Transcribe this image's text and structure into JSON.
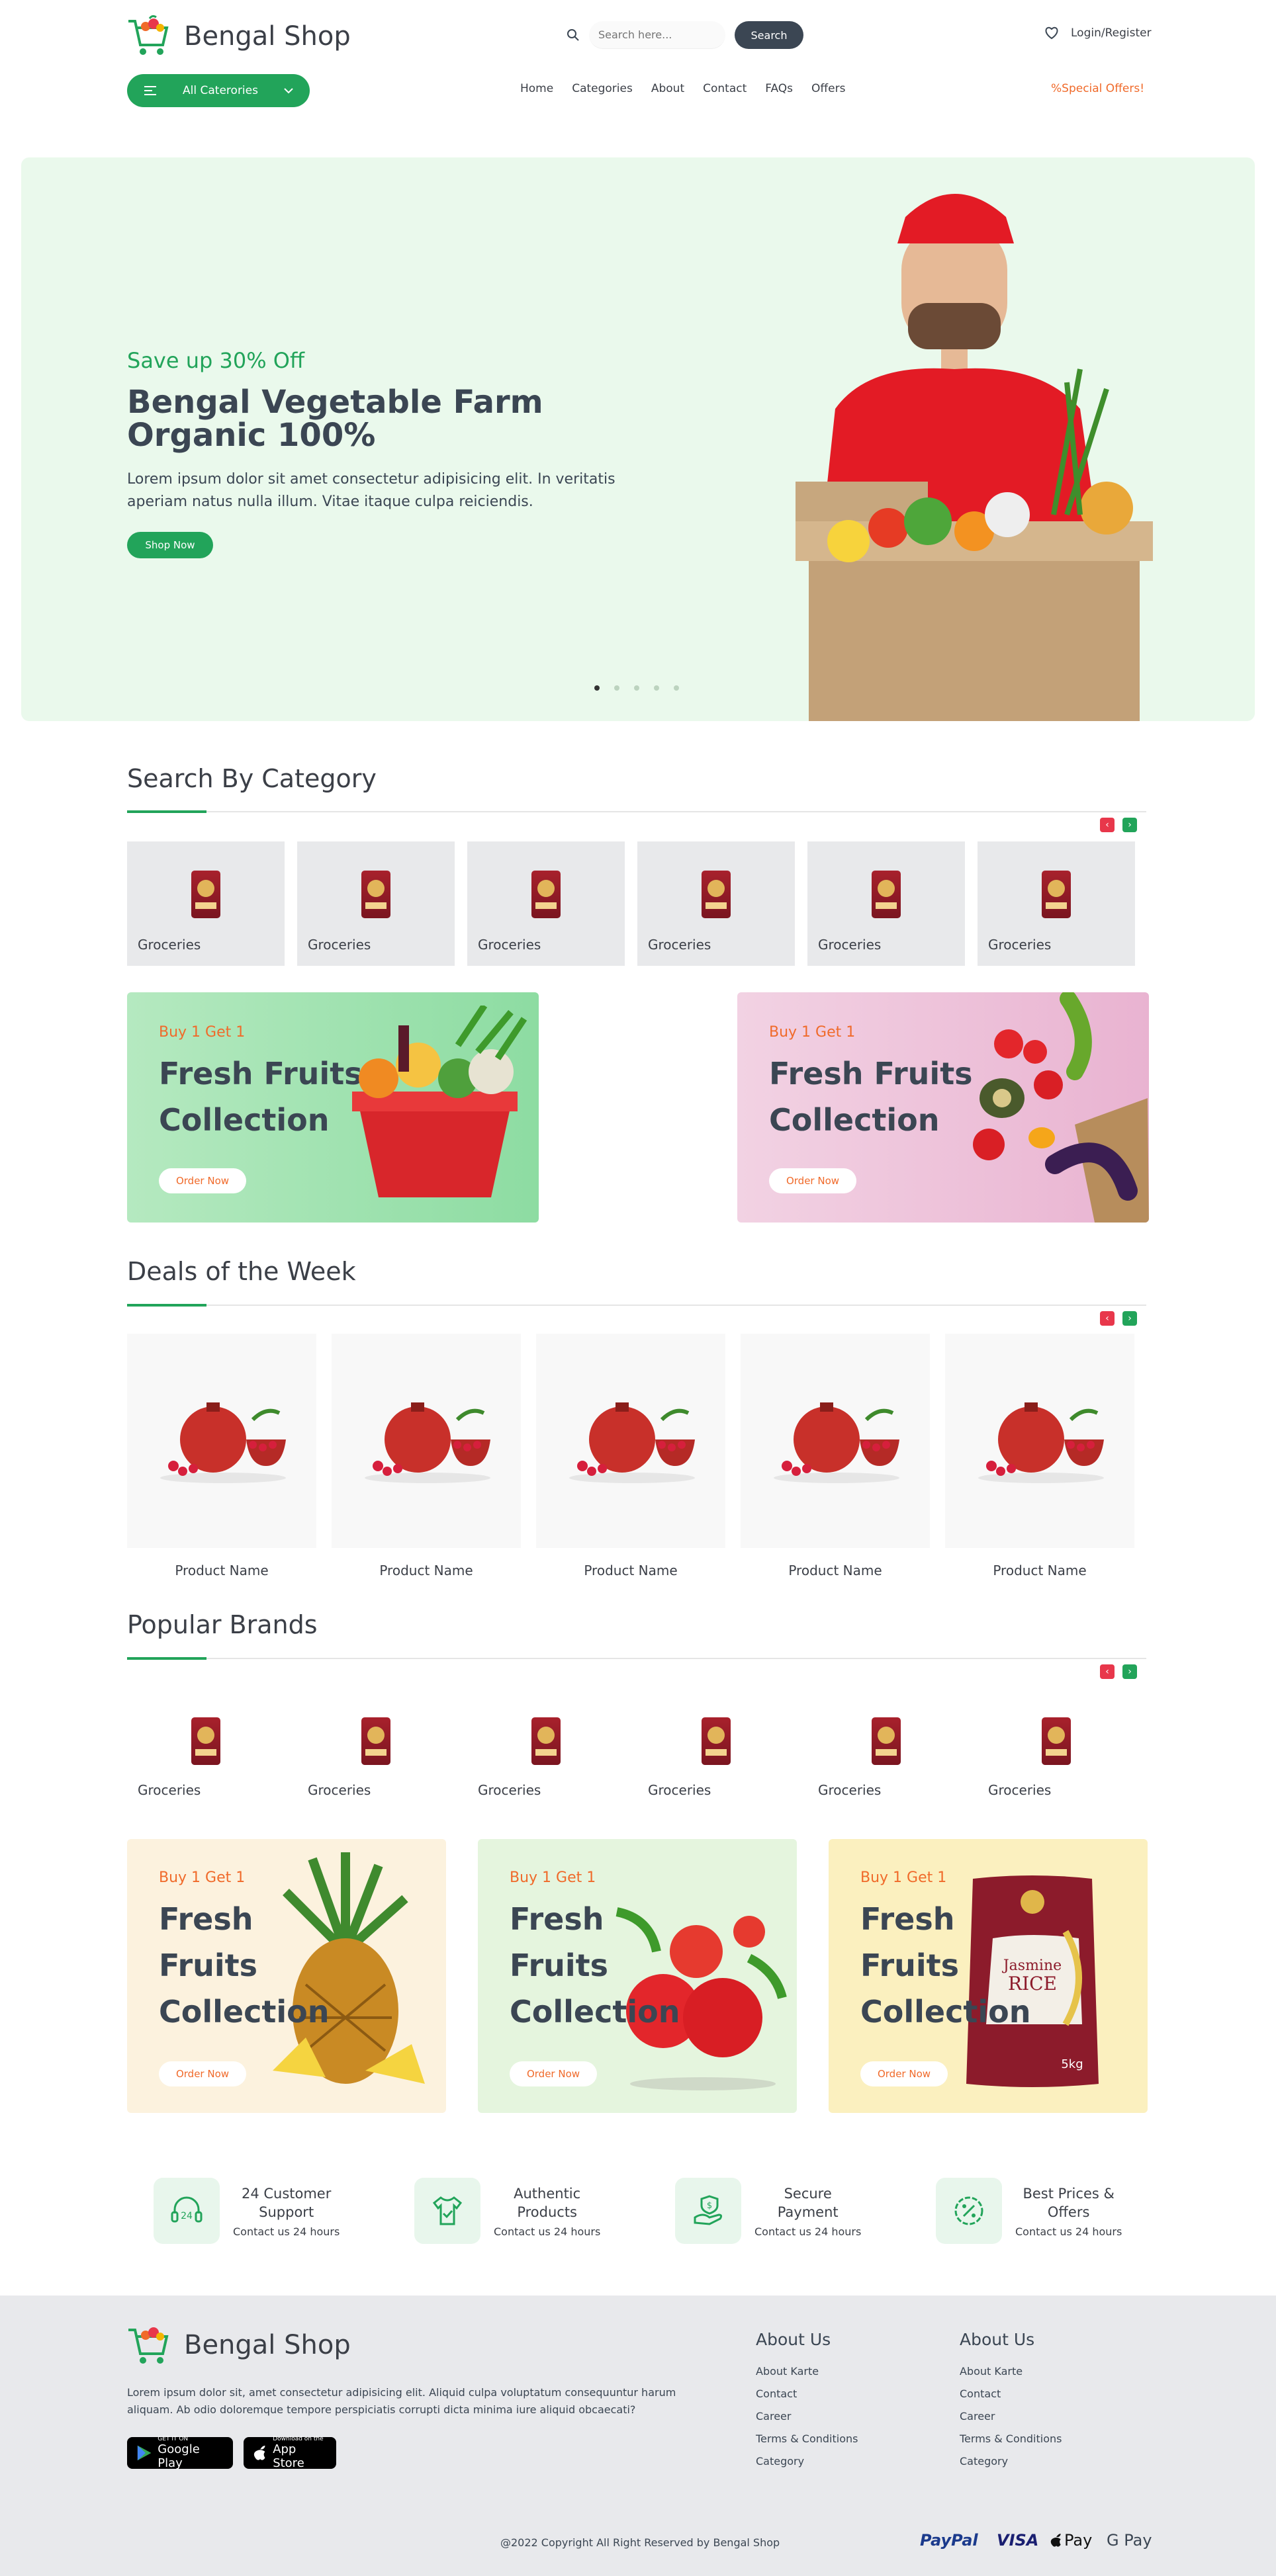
{
  "brand": {
    "name": "Bengal Shop"
  },
  "header": {
    "search_placeholder": "Search here...",
    "search_label": "Search",
    "login": "Login/Register",
    "all_categories": "All Caterories",
    "nav": [
      "Home",
      "Categories",
      "About",
      "Contact",
      "FAQs",
      "Offers"
    ],
    "special": "Special Offers!"
  },
  "hero": {
    "kicker": "Save up 30% Off",
    "title": "Bengal Vegetable Farm Organic 100%",
    "text": "Lorem ipsum dolor sit amet consectetur adipisicing elit. In veritatis aperiam natus nulla illum. Vitae itaque culpa reiciendis.",
    "button": "Shop Now"
  },
  "category": {
    "title": "Search By Category",
    "items": [
      "Groceries",
      "Groceries",
      "Groceries",
      "Groceries",
      "Groceries",
      "Groceries"
    ]
  },
  "promo_wide": [
    {
      "tag": "Buy 1 Get 1",
      "line1": "Fresh Fruits",
      "line2": "Collection",
      "button": "Order Now"
    },
    {
      "tag": "Buy 1 Get 1",
      "line1": "Fresh Fruits",
      "line2": "Collection",
      "button": "Order Now"
    }
  ],
  "deals": {
    "title": "Deals of the Week",
    "items": [
      "Product Name",
      "Product Name",
      "Product Name",
      "Product Name",
      "Product Name"
    ]
  },
  "brands": {
    "title": "Popular Brands",
    "items": [
      "Groceries",
      "Groceries",
      "Groceries",
      "Groceries",
      "Groceries",
      "Groceries"
    ]
  },
  "promo_small": [
    {
      "tag": "Buy 1 Get 1",
      "l1": "Fresh",
      "l2": "Fruits",
      "l3": "Collection",
      "button": "Order Now"
    },
    {
      "tag": "Buy 1 Get 1",
      "l1": "Fresh",
      "l2": "Fruits",
      "l3": "Collection",
      "button": "Order Now"
    },
    {
      "tag": "Buy 1 Get 1",
      "l1": "Fresh",
      "l2": "Fruits",
      "l3": "Collection",
      "button": "Order Now"
    }
  ],
  "rice_pack": {
    "l1": "Jasmine",
    "l2": "RICE",
    "w": "5kg"
  },
  "features": [
    {
      "t1": "24 Customer",
      "t2": "Support",
      "sub": "Contact us 24 hours"
    },
    {
      "t1": "Authentic",
      "t2": "Products",
      "sub": "Contact us 24 hours"
    },
    {
      "t1": "Secure",
      "t2": "Payment",
      "sub": "Contact us 24 hours"
    },
    {
      "t1": "Best Prices &",
      "t2": "Offers",
      "sub": "Contact us 24 hours"
    }
  ],
  "footer": {
    "about": "Lorem ipsum dolor sit, amet consectetur adipisicing elit. Aliquid culpa voluptatum consequuntur harum aliquam. Ab odio doloremque tempore perspiciatis corrupti dicta minima iure aliquid obcaecati?",
    "google_small": "GET IT ON",
    "google": "Google Play",
    "apple_small": "Download on the",
    "apple": "App Store",
    "cols": [
      {
        "title": "About Us",
        "links": [
          "About Karte",
          "Contact",
          "Career",
          "Terms & Conditions",
          "Category"
        ]
      },
      {
        "title": "About Us",
        "links": [
          "About Karte",
          "Contact",
          "Career",
          "Terms & Conditions",
          "Category"
        ]
      }
    ],
    "copyright": "@2022 Copyright All Right Reserved by Bengal Shop",
    "payments": [
      "PayPal",
      "VISA",
      "Pay",
      "G Pay"
    ]
  },
  "colors": {
    "accent": "#22a45a",
    "orange": "#f06a2a",
    "dark": "#3b4653"
  }
}
